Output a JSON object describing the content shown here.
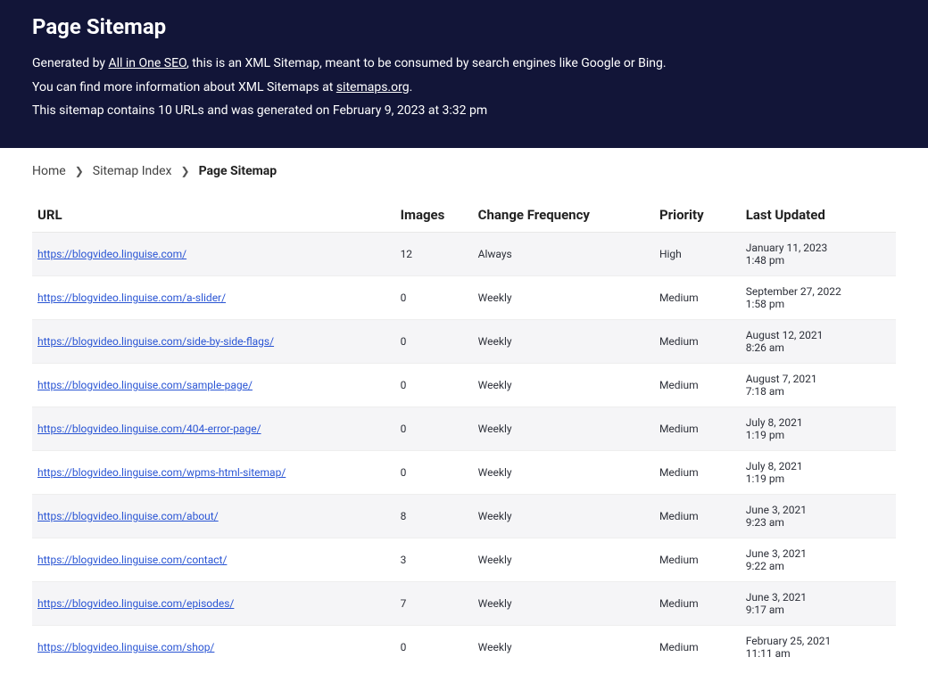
{
  "header": {
    "title": "Page Sitemap",
    "line1_prefix": "Generated by ",
    "line1_link": "All in One SEO",
    "line1_suffix": ", this is an XML Sitemap, meant to be consumed by search engines like Google or Bing.",
    "line2_prefix": "You can find more information about XML Sitemaps at ",
    "line2_link": "sitemaps.org",
    "line2_suffix": ".",
    "line3": "This sitemap contains 10 URLs and was generated on February 9, 2023 at 3:32 pm"
  },
  "breadcrumb": {
    "home": "Home",
    "index": "Sitemap Index",
    "current": "Page Sitemap",
    "sep": "❯"
  },
  "table": {
    "headers": {
      "url": "URL",
      "images": "Images",
      "freq": "Change Frequency",
      "priority": "Priority",
      "updated": "Last Updated"
    },
    "rows": [
      {
        "url": "https://blogvideo.linguise.com/",
        "images": "12",
        "freq": "Always",
        "priority": "High",
        "date": "January 11, 2023",
        "time": "1:48 pm"
      },
      {
        "url": "https://blogvideo.linguise.com/a-slider/",
        "images": "0",
        "freq": "Weekly",
        "priority": "Medium",
        "date": "September 27, 2022",
        "time": "1:58 pm"
      },
      {
        "url": "https://blogvideo.linguise.com/side-by-side-flags/",
        "images": "0",
        "freq": "Weekly",
        "priority": "Medium",
        "date": "August 12, 2021",
        "time": "8:26 am"
      },
      {
        "url": "https://blogvideo.linguise.com/sample-page/",
        "images": "0",
        "freq": "Weekly",
        "priority": "Medium",
        "date": "August 7, 2021",
        "time": "7:18 am"
      },
      {
        "url": "https://blogvideo.linguise.com/404-error-page/",
        "images": "0",
        "freq": "Weekly",
        "priority": "Medium",
        "date": "July 8, 2021",
        "time": "1:19 pm"
      },
      {
        "url": "https://blogvideo.linguise.com/wpms-html-sitemap/",
        "images": "0",
        "freq": "Weekly",
        "priority": "Medium",
        "date": "July 8, 2021",
        "time": "1:19 pm"
      },
      {
        "url": "https://blogvideo.linguise.com/about/",
        "images": "8",
        "freq": "Weekly",
        "priority": "Medium",
        "date": "June 3, 2021",
        "time": "9:23 am"
      },
      {
        "url": "https://blogvideo.linguise.com/contact/",
        "images": "3",
        "freq": "Weekly",
        "priority": "Medium",
        "date": "June 3, 2021",
        "time": "9:22 am"
      },
      {
        "url": "https://blogvideo.linguise.com/episodes/",
        "images": "7",
        "freq": "Weekly",
        "priority": "Medium",
        "date": "June 3, 2021",
        "time": "9:17 am"
      },
      {
        "url": "https://blogvideo.linguise.com/shop/",
        "images": "0",
        "freq": "Weekly",
        "priority": "Medium",
        "date": "February 25, 2021",
        "time": "11:11 am"
      }
    ]
  }
}
